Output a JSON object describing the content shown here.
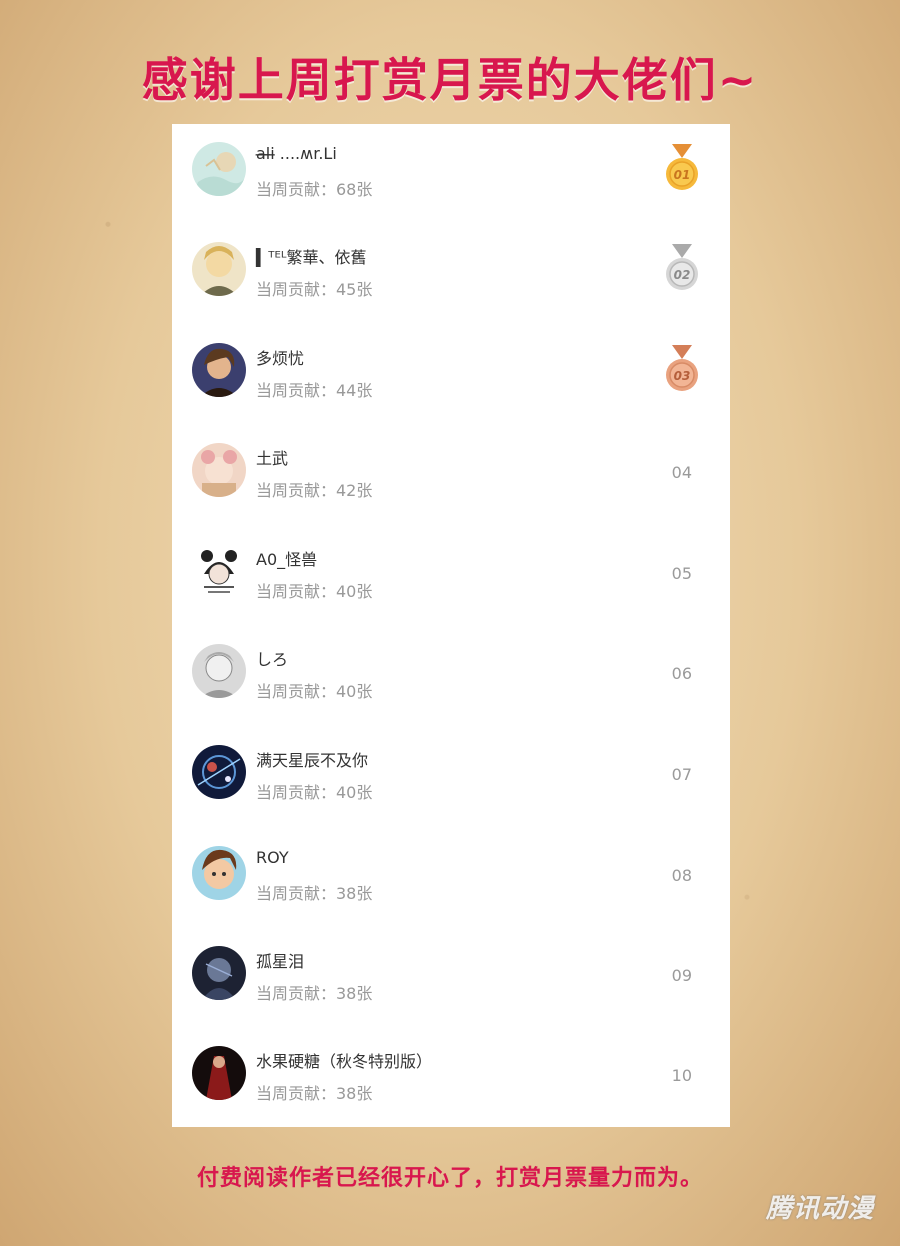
{
  "header": {
    "title": "感谢上周打赏月票的大佬们~"
  },
  "leaderboard": {
    "rows": [
      {
        "name": "a̶l̶i̶ ....ʍr.Li",
        "contribution": "当周贡献：68张",
        "rank": "01",
        "medal": "gold"
      },
      {
        "name": "▍ᵀᴱᴸ繁華、依舊",
        "contribution": "当周贡献：45张",
        "rank": "02",
        "medal": "silver"
      },
      {
        "name": "多烦忧",
        "contribution": "当周贡献：44张",
        "rank": "03",
        "medal": "bronze"
      },
      {
        "name": "土武",
        "contribution": "当周贡献：42张",
        "rank": "04",
        "medal": ""
      },
      {
        "name": "A0_怪兽",
        "contribution": "当周贡献：40张",
        "rank": "05",
        "medal": ""
      },
      {
        "name": "しろ",
        "contribution": "当周贡献：40张",
        "rank": "06",
        "medal": ""
      },
      {
        "name": "满天星辰不及你",
        "contribution": "当周贡献：40张",
        "rank": "07",
        "medal": ""
      },
      {
        "name": "ROY",
        "contribution": "当周贡献：38张",
        "rank": "08",
        "medal": ""
      },
      {
        "name": "孤星泪",
        "contribution": "当周贡献：38张",
        "rank": "09",
        "medal": ""
      },
      {
        "name": "水果硬糖（秋冬特别版）",
        "contribution": "当周贡献：38张",
        "rank": "10",
        "medal": ""
      }
    ]
  },
  "footer": {
    "text": "付费阅读作者已经很开心了，打赏月票量力而为。"
  },
  "watermark": {
    "text": "腾讯动漫"
  },
  "colors": {
    "accent": "#d8174e",
    "gold": "#f6b93b",
    "silver": "#c9c9c9",
    "bronze": "#e9a27f"
  }
}
